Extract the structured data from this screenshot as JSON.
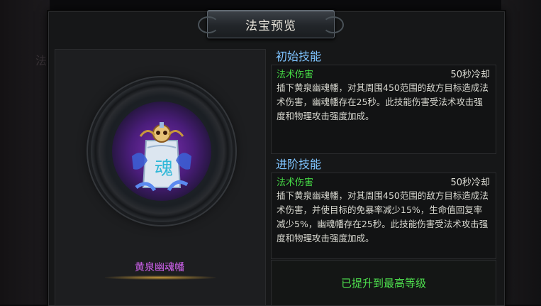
{
  "background": {
    "ghost_char": "法"
  },
  "window": {
    "title": "法宝预览"
  },
  "treasure": {
    "name": "黄泉幽魂幡",
    "icon": "banner-skull-icon",
    "name_color": "#d463f2"
  },
  "initial_skill": {
    "section_title": "初始技能",
    "type": "法术伤害",
    "cooldown": "50秒冷却",
    "description": "插下黄泉幽魂幡，对其周围450范围的敌方目标造成法术伤害，幽魂幡存在25秒。此技能伤害受法术攻击强度和物理攻击强度加成。"
  },
  "advanced_skill": {
    "section_title": "进阶技能",
    "type": "法术伤害",
    "cooldown": "50秒冷却",
    "description": "插下黄泉幽魂幡，对其周围450范围的敌方目标造成法术伤害，并使目标的免暴率减少15%，生命值回复率减少5%，幽魂幡存在25秒。此技能伤害受法术攻击强度和物理攻击强度加成。"
  },
  "status": {
    "max_level_text": "已提升到最高等级"
  },
  "colors": {
    "section_title": "#7fc4ff",
    "skill_type": "#45d845",
    "max_level": "#4ee04e"
  }
}
